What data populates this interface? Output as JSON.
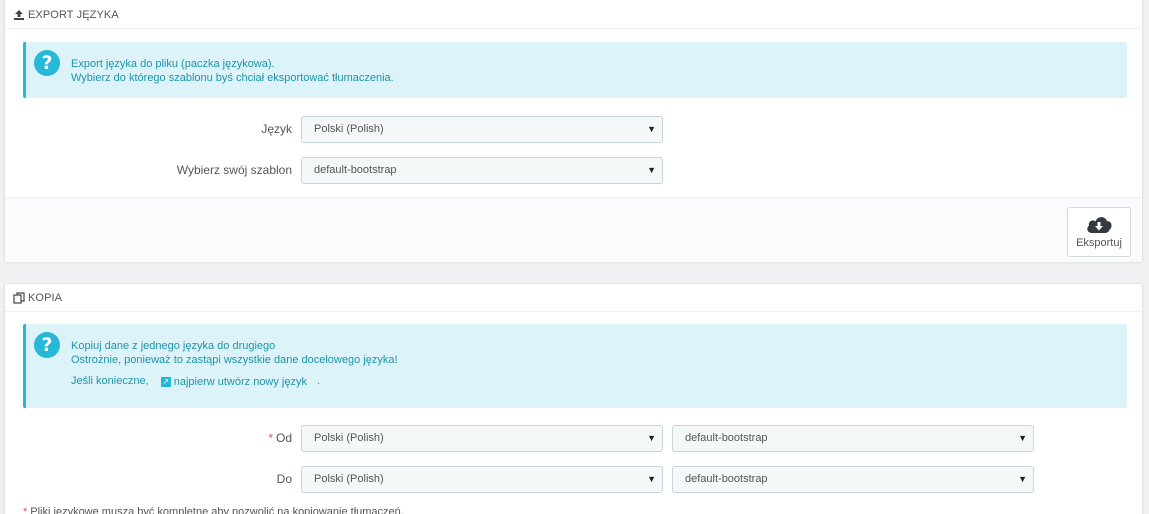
{
  "export": {
    "heading": "EXPORT JĘZYKA",
    "alert_line1": "Export języka do pliku (paczka językowa).",
    "alert_line2": "Wybierz do którego szablonu byś chciał eksportować tłumaczenia.",
    "language_label": "Język",
    "language_value": "Polski (Polish)",
    "theme_label": "Wybierz swój szablon",
    "theme_value": "default-bootstrap",
    "button_label": "Eksportuj"
  },
  "copy": {
    "heading": "KOPIA",
    "alert_line1": "Kopiuj dane z jednego języka do drugiego",
    "alert_line2": "Ostrożnie, ponieważ to zastąpi wszystkie dane docelowego języka!",
    "alert_line3_prefix": "Jeśli konieczne,",
    "alert_link": "najpierw utwórz nowy język",
    "alert_line3_suffix": ".",
    "from_required": "*",
    "from_label": "Od",
    "from_language": "Polski (Polish)",
    "from_theme": "default-bootstrap",
    "to_label": "Do",
    "to_language": "Polski (Polish)",
    "to_theme": "default-bootstrap",
    "note_required": "*",
    "note_text": "Pliki językowe muszą być kompletne aby pozwolić na kopiowanie tłumaczeń."
  },
  "colors": {
    "info_bg": "#dcf4f9",
    "info_accent": "#25b9d7",
    "required": "#e94e4e"
  }
}
